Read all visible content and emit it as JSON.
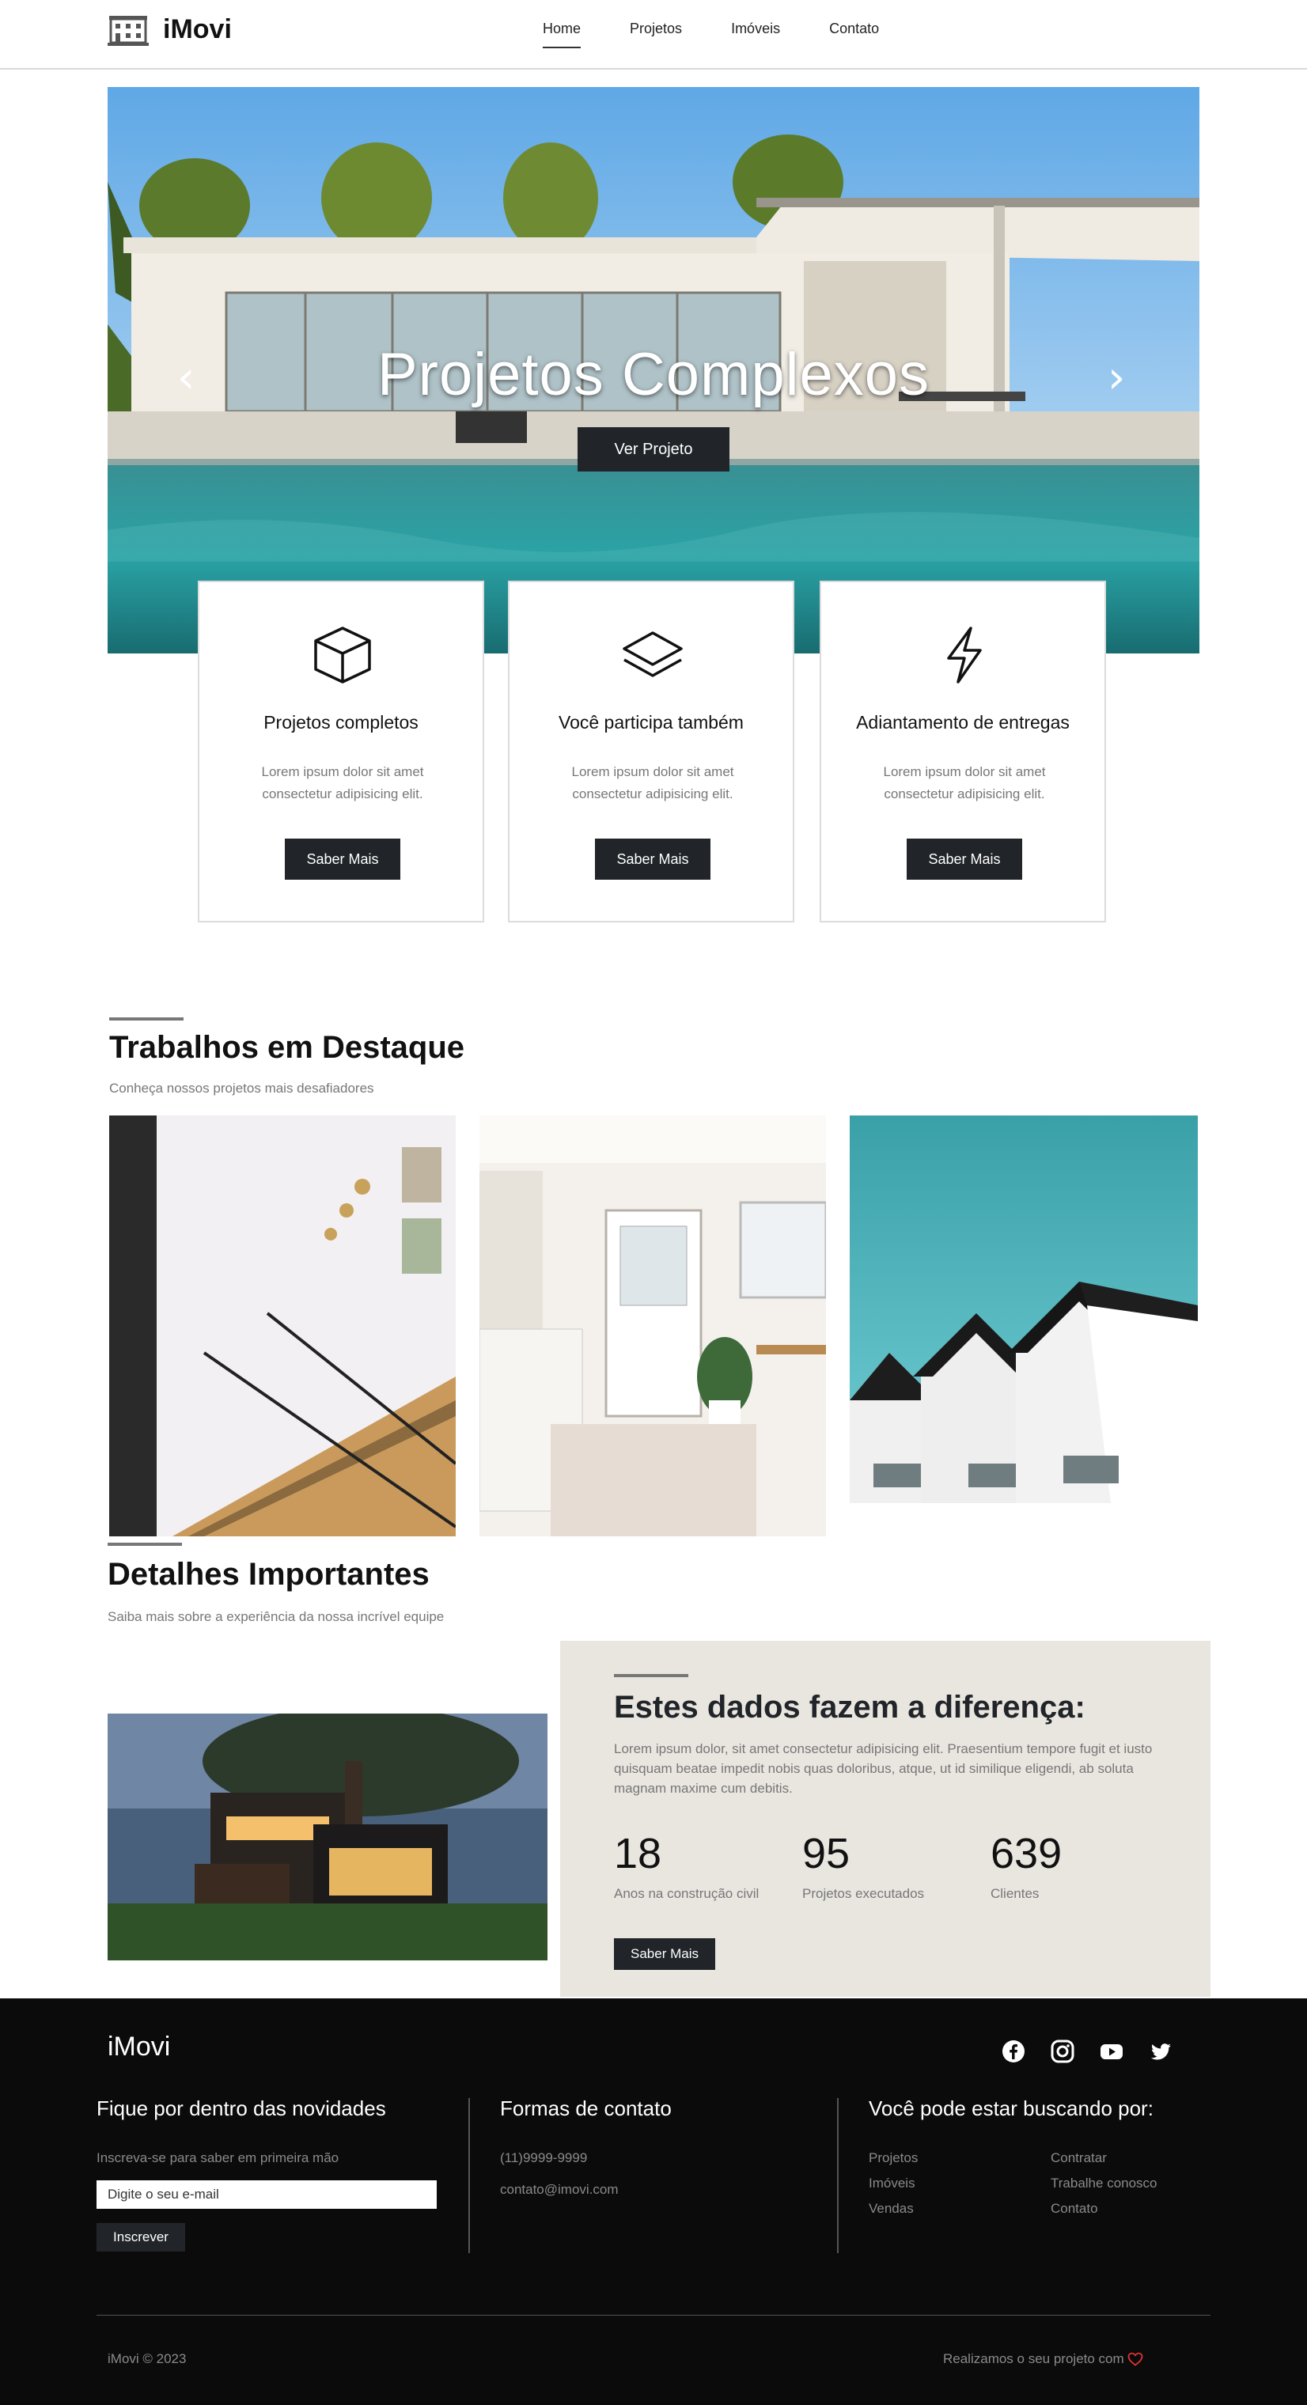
{
  "nav": {
    "brand": "iMovi",
    "links": [
      {
        "label": "Home",
        "active": true
      },
      {
        "label": "Projetos",
        "active": false
      },
      {
        "label": "Imóveis",
        "active": false
      },
      {
        "label": "Contato",
        "active": false
      }
    ]
  },
  "hero": {
    "title": "Projetos Complexos",
    "button": "Ver Projeto",
    "prev_icon": "chevron-left",
    "next_icon": "chevron-right"
  },
  "features": [
    {
      "icon": "cube-icon",
      "title": "Projetos completos",
      "text": "Lorem ipsum dolor sit amet consectetur adipisicing elit.",
      "button": "Saber Mais"
    },
    {
      "icon": "layers-icon",
      "title": "Você participa também",
      "text": "Lorem ipsum dolor sit amet consectetur adipisicing elit.",
      "button": "Saber Mais"
    },
    {
      "icon": "lightning-icon",
      "title": "Adiantamento de entregas",
      "text": "Lorem ipsum dolor sit amet consectetur adipisicing elit.",
      "button": "Saber Mais"
    }
  ],
  "featured": {
    "title": "Trabalhos em Destaque",
    "subtitle": "Conheça nossos projetos mais desafiadores"
  },
  "details": {
    "title": "Detalhes Importantes",
    "subtitle": "Saiba mais sobre a experiência da nossa incrível equipe"
  },
  "stats": {
    "title": "Estes dados fazem a diferença:",
    "text": "Lorem ipsum dolor, sit amet consectetur adipisicing elit. Praesentium tempore fugit et iusto quisquam beatae impedit nobis quas doloribus, atque, ut id similique eligendi, ab soluta magnam maxime cum debitis.",
    "items": [
      {
        "value": "18",
        "label": "Anos na construção civil"
      },
      {
        "value": "95",
        "label": "Projetos executados"
      },
      {
        "value": "639",
        "label": "Clientes"
      }
    ],
    "button": "Saber Mais"
  },
  "footer": {
    "brand": "iMovi",
    "social": [
      "facebook-icon",
      "instagram-icon",
      "youtube-icon",
      "twitter-icon"
    ],
    "newsletter": {
      "title": "Fique por dentro das novidades",
      "text": "Inscreva-se para saber em primeira mão",
      "placeholder": "Digite o seu e-mail",
      "button": "Inscrever"
    },
    "contact": {
      "title": "Formas de contato",
      "phone": "(11)9999-9999",
      "email": "contato@imovi.com"
    },
    "search": {
      "title": "Você pode estar buscando por:",
      "col1": [
        "Projetos",
        "Imóveis",
        "Vendas"
      ],
      "col2": [
        "Contratar",
        "Trabalhe conosco",
        "Contato"
      ]
    },
    "copyright": "iMovi © 2023",
    "made_with": "Realizamos o seu projeto com",
    "heart_color": "#e03131"
  }
}
